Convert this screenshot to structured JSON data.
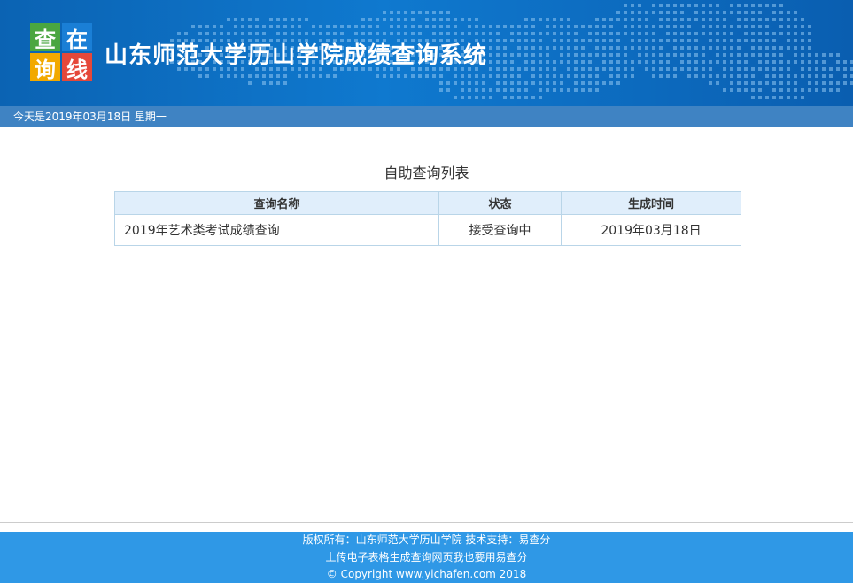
{
  "header": {
    "logo_chars": [
      "查",
      "在",
      "询",
      "线"
    ],
    "title": "山东师范大学历山学院成绩查询系统"
  },
  "datebar": {
    "date_text": "今天是2019年03月18日  星期一"
  },
  "list": {
    "title": "自助查询列表",
    "columns": [
      "查询名称",
      "状态",
      "生成时间"
    ],
    "rows": [
      {
        "name": "2019年艺术类考试成绩查询",
        "status": "接受查询中",
        "time": "2019年03月18日"
      }
    ]
  },
  "footer": {
    "line1": "版权所有：山东师范大学历山学院 技术支持：易查分",
    "line2": "上传电子表格生成查询网页我也要用易查分",
    "line3": "© Copyright www.yichafen.com 2018"
  },
  "colors": {
    "header_bg": "#0f79cf",
    "datebar_bg": "#3f83c3",
    "table_header_bg": "#e0eefb",
    "footer_bg": "#2f98e6"
  }
}
